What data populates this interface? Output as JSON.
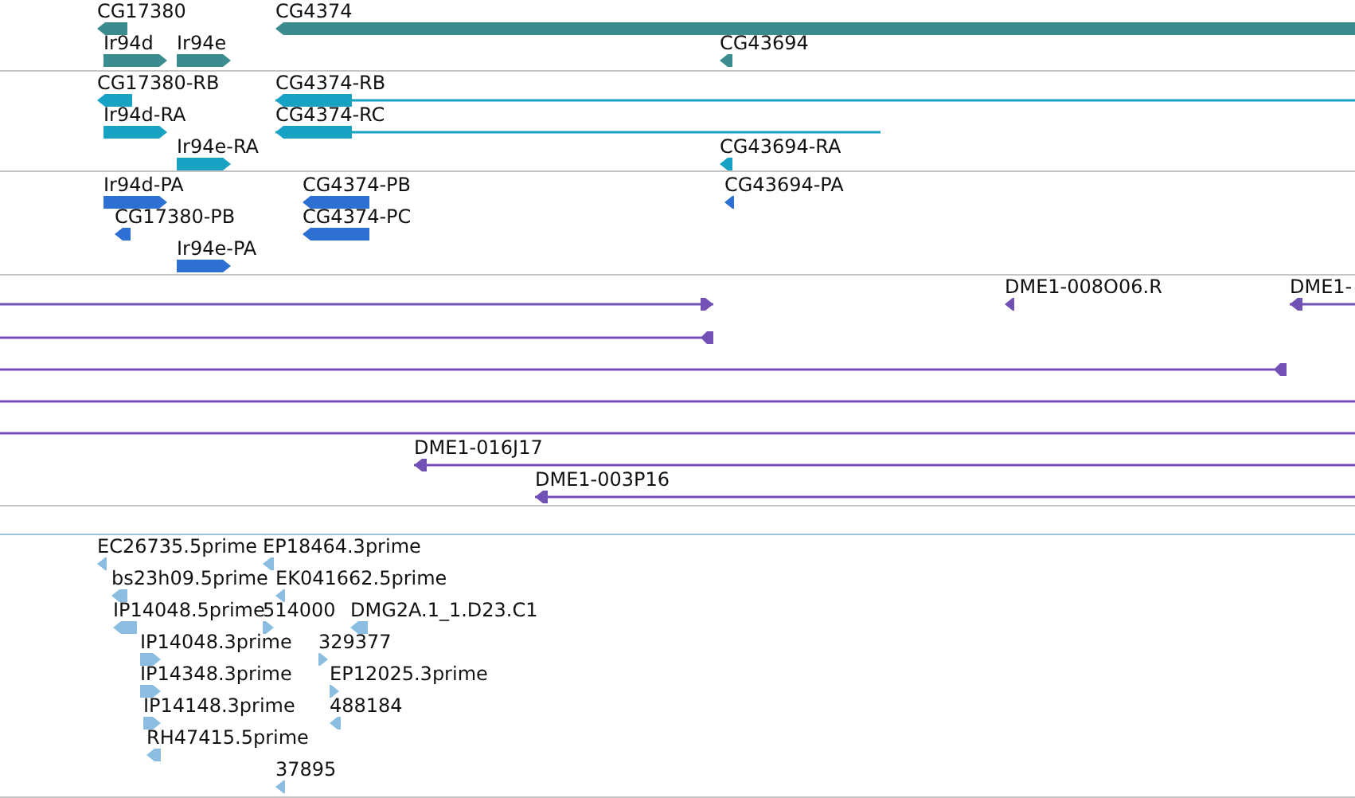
{
  "tracks": [
    {
      "color": "#3a8c8e",
      "features": [
        {
          "label": "CG17380",
          "reverse": true
        },
        {
          "label": "CG4374",
          "reverse": true
        },
        {
          "label": "Ir94d",
          "reverse": false
        },
        {
          "label": "Ir94e",
          "reverse": false
        },
        {
          "label": "CG43694",
          "reverse": true
        }
      ]
    },
    {
      "color": "#17a2c4",
      "features": [
        {
          "label": "CG17380-RB",
          "reverse": true
        },
        {
          "label": "CG4374-RB",
          "reverse": true
        },
        {
          "label": "Ir94d-RA",
          "reverse": false
        },
        {
          "label": "CG4374-RC",
          "reverse": true
        },
        {
          "label": "Ir94e-RA",
          "reverse": false
        },
        {
          "label": "CG43694-RA",
          "reverse": true
        }
      ]
    },
    {
      "color": "#2e6fd3",
      "features": [
        {
          "label": "Ir94d-PA",
          "reverse": false
        },
        {
          "label": "CG4374-PB",
          "reverse": true
        },
        {
          "label": "CG43694-PA",
          "reverse": true
        },
        {
          "label": "CG17380-PB",
          "reverse": true
        },
        {
          "label": "CG4374-PC",
          "reverse": true
        },
        {
          "label": "Ir94e-PA",
          "reverse": false
        }
      ]
    },
    {
      "color": "#7251b5",
      "features": [
        {
          "kind": "arrow",
          "label": "DME1-008O06.R",
          "reverse": true
        },
        {
          "kind": "arrow",
          "label": "DME1-",
          "reverse": true
        },
        {
          "kind": "arrow",
          "reverse": false
        },
        {
          "kind": "arrow",
          "reverse": true
        },
        {
          "kind": "arrow",
          "reverse": true
        },
        {
          "kind": "line"
        },
        {
          "kind": "line"
        },
        {
          "kind": "arrow",
          "label": "DME1-016J17",
          "reverse": true
        },
        {
          "kind": "arrow",
          "label": "DME1-003P16",
          "reverse": true
        }
      ]
    },
    {
      "color": "#8bbde0",
      "features": [
        {
          "label": "EC26735.5prime",
          "reverse": true
        },
        {
          "label": "EP18464.3prime",
          "reverse": true
        },
        {
          "label": "bs23h09.5prime",
          "reverse": true
        },
        {
          "label": "EK041662.5prime",
          "reverse": true
        },
        {
          "label": "IP14048.5prime",
          "reverse": true
        },
        {
          "label": "514000",
          "reverse": false
        },
        {
          "label": "DMG2A.1_1.D23.C1",
          "reverse": true
        },
        {
          "label": "IP14048.3prime",
          "reverse": false
        },
        {
          "label": "329377",
          "reverse": false
        },
        {
          "label": "IP14348.3prime",
          "reverse": false
        },
        {
          "label": "EP12025.3prime",
          "reverse": false
        },
        {
          "label": "IP14148.3prime",
          "reverse": false
        },
        {
          "label": "488184",
          "reverse": true
        },
        {
          "label": "RH47415.5prime",
          "reverse": true
        },
        {
          "label": "37895",
          "reverse": true
        }
      ]
    }
  ]
}
